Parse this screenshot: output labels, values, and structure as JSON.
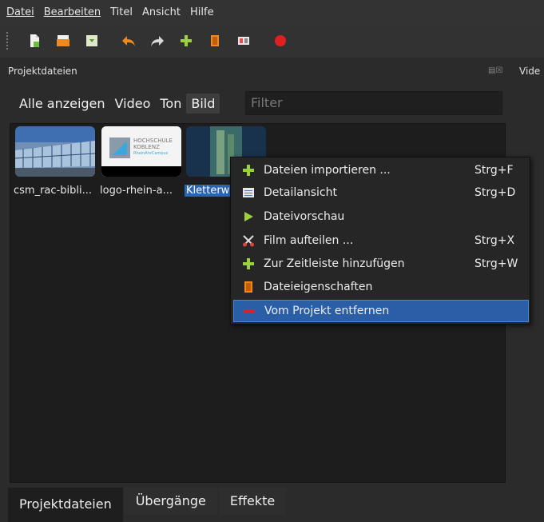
{
  "menubar": {
    "items": [
      "Datei",
      "Bearbeiten",
      "Titel",
      "Ansicht",
      "Hilfe"
    ],
    "underlined_first_letter": [
      true,
      true,
      false,
      false,
      false
    ]
  },
  "toolbar": {
    "icons": [
      "new-project-icon",
      "open-project-icon",
      "save-project-icon",
      "undo-icon",
      "redo-icon",
      "import-files-icon",
      "profile-icon",
      "fullscreen-icon",
      "export-video-icon"
    ]
  },
  "dock": {
    "title": "Projektdateien",
    "right_panel_label": "Vide"
  },
  "filter": {
    "buttons": [
      "Alle anzeigen",
      "Video",
      "Ton",
      "Bild"
    ],
    "active": "Bild",
    "placeholder": "Filter"
  },
  "files": [
    {
      "name": "csm_rac-bibli...",
      "selected": false
    },
    {
      "name": "logo-rhein-a...",
      "selected": false,
      "logo_line1": "HOCHSCHULE",
      "logo_line2": "KOBLENZ",
      "logo_line3": "RheinAhrCampus"
    },
    {
      "name": "Kletterwa",
      "selected": true
    }
  ],
  "context_menu": {
    "items": [
      {
        "label": "Dateien importieren ...",
        "shortcut": "Strg+F",
        "icon": "plus-icon"
      },
      {
        "label": "Detailansicht",
        "shortcut": "Strg+D",
        "icon": "details-icon"
      },
      {
        "label": "Dateivorschau",
        "shortcut": "",
        "icon": "play-icon"
      },
      {
        "label": "Film aufteilen ...",
        "shortcut": "Strg+X",
        "icon": "scissors-icon"
      },
      {
        "label": "Zur Zeitleiste hinzufügen",
        "shortcut": "Strg+W",
        "icon": "plus-icon"
      },
      {
        "label": "Dateieigenschaften",
        "shortcut": "",
        "icon": "properties-icon"
      },
      {
        "label": "Vom Projekt entfernen",
        "shortcut": "",
        "icon": "minus-icon",
        "highlighted": true
      }
    ]
  },
  "tabs": [
    "Projektdateien",
    "Übergänge",
    "Effekte"
  ],
  "colors": {
    "highlight": "#2a5fa8",
    "accent_green": "#9bd23c",
    "accent_orange": "#f08a1c",
    "record_red": "#e02020"
  }
}
